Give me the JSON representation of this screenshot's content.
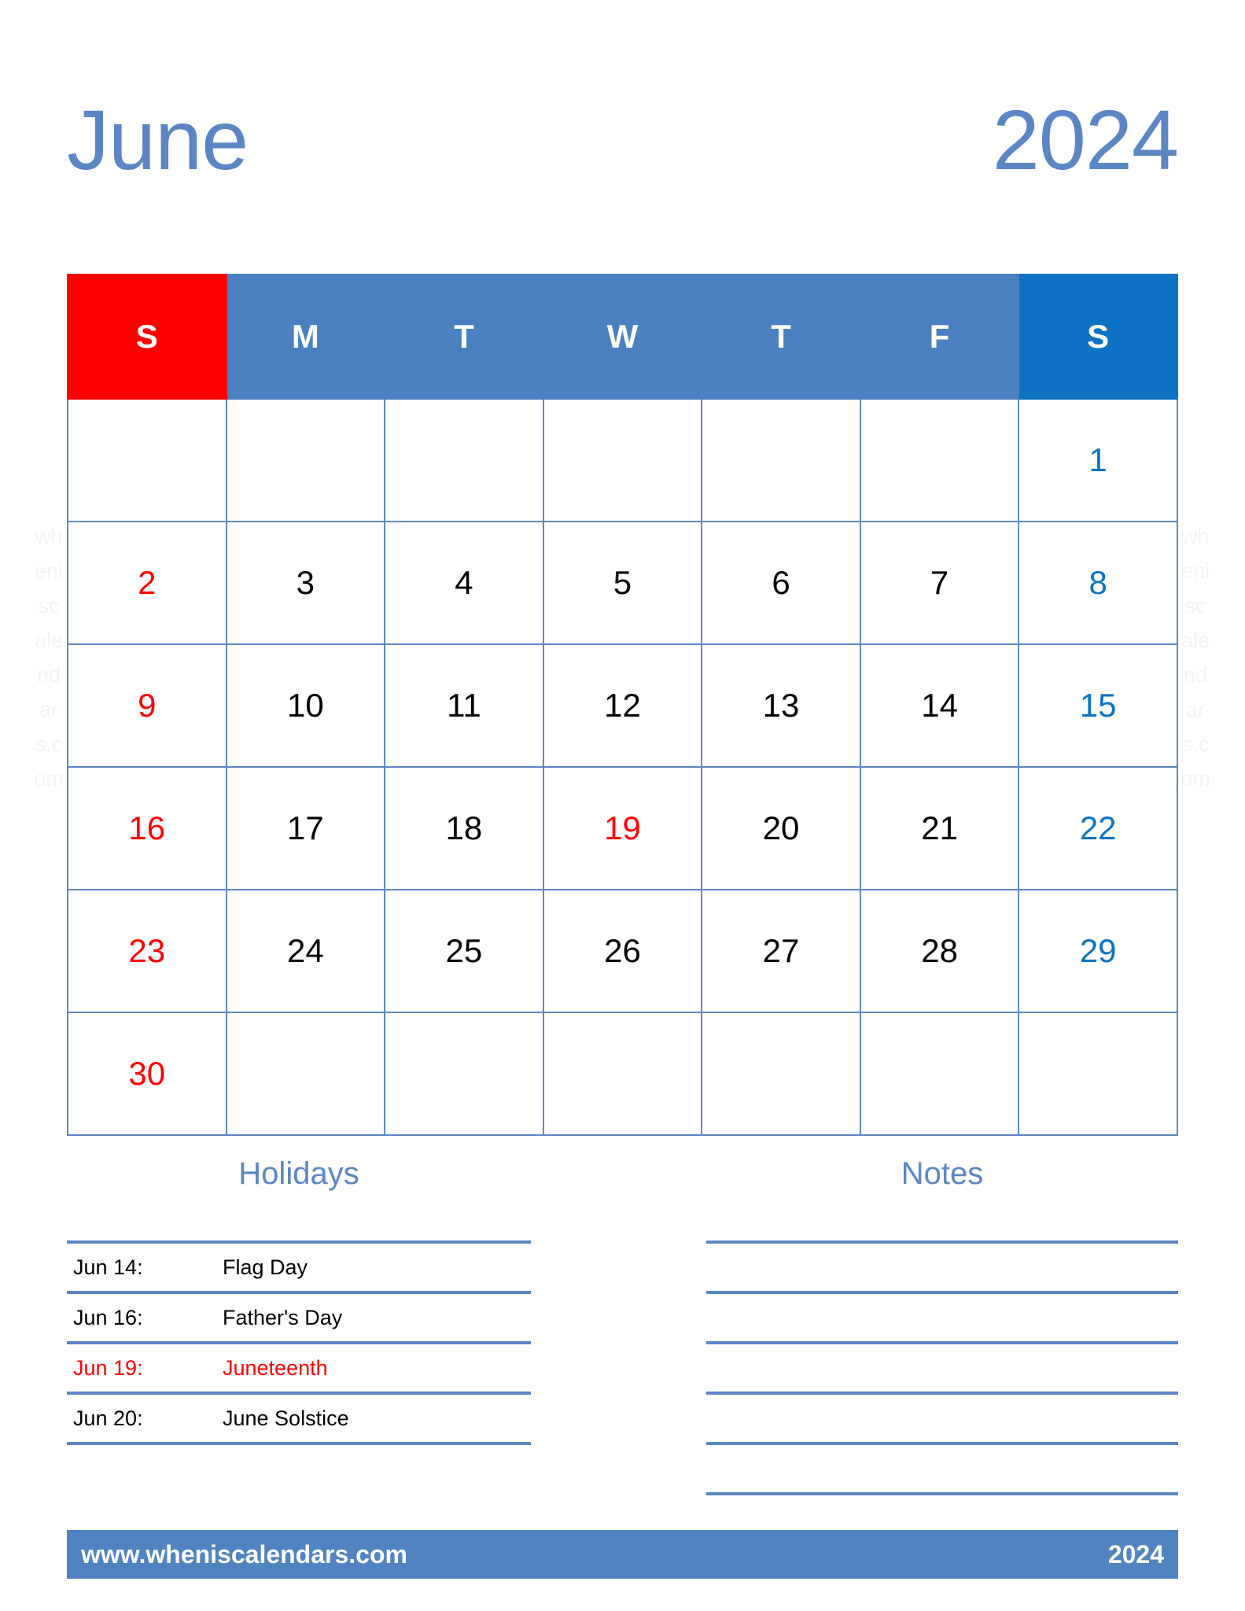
{
  "header": {
    "month": "June",
    "year": "2024"
  },
  "colors": {
    "title_blue": "#5b86c4",
    "header_blue": "#4a80c0",
    "saturday_blue": "#0b72c4",
    "sunday_red": "#ff0000",
    "grid_line": "#5b86c4",
    "footer_bar": "#5183c0"
  },
  "watermark": {
    "text": "wheniscalendars.com"
  },
  "calendar": {
    "weekday_headers": [
      {
        "label": "S",
        "kind": "sun"
      },
      {
        "label": "M",
        "kind": "weekday"
      },
      {
        "label": "T",
        "kind": "weekday"
      },
      {
        "label": "W",
        "kind": "weekday"
      },
      {
        "label": "T",
        "kind": "weekday"
      },
      {
        "label": "F",
        "kind": "weekday"
      },
      {
        "label": "S",
        "kind": "sat"
      }
    ],
    "weeks": [
      [
        {
          "day": "",
          "kind": "sun"
        },
        {
          "day": "",
          "kind": "weekday"
        },
        {
          "day": "",
          "kind": "weekday"
        },
        {
          "day": "",
          "kind": "weekday"
        },
        {
          "day": "",
          "kind": "weekday"
        },
        {
          "day": "",
          "kind": "weekday"
        },
        {
          "day": "1",
          "kind": "sat"
        }
      ],
      [
        {
          "day": "2",
          "kind": "sun"
        },
        {
          "day": "3",
          "kind": "weekday"
        },
        {
          "day": "4",
          "kind": "weekday"
        },
        {
          "day": "5",
          "kind": "weekday"
        },
        {
          "day": "6",
          "kind": "weekday"
        },
        {
          "day": "7",
          "kind": "weekday"
        },
        {
          "day": "8",
          "kind": "sat"
        }
      ],
      [
        {
          "day": "9",
          "kind": "sun"
        },
        {
          "day": "10",
          "kind": "weekday"
        },
        {
          "day": "11",
          "kind": "weekday"
        },
        {
          "day": "12",
          "kind": "weekday"
        },
        {
          "day": "13",
          "kind": "weekday"
        },
        {
          "day": "14",
          "kind": "weekday"
        },
        {
          "day": "15",
          "kind": "sat"
        }
      ],
      [
        {
          "day": "16",
          "kind": "sun"
        },
        {
          "day": "17",
          "kind": "weekday"
        },
        {
          "day": "18",
          "kind": "weekday"
        },
        {
          "day": "19",
          "kind": "holiday"
        },
        {
          "day": "20",
          "kind": "weekday"
        },
        {
          "day": "21",
          "kind": "weekday"
        },
        {
          "day": "22",
          "kind": "sat"
        }
      ],
      [
        {
          "day": "23",
          "kind": "sun"
        },
        {
          "day": "24",
          "kind": "weekday"
        },
        {
          "day": "25",
          "kind": "weekday"
        },
        {
          "day": "26",
          "kind": "weekday"
        },
        {
          "day": "27",
          "kind": "weekday"
        },
        {
          "day": "28",
          "kind": "weekday"
        },
        {
          "day": "29",
          "kind": "sat"
        }
      ],
      [
        {
          "day": "30",
          "kind": "sun"
        },
        {
          "day": "",
          "kind": "weekday"
        },
        {
          "day": "",
          "kind": "weekday"
        },
        {
          "day": "",
          "kind": "weekday"
        },
        {
          "day": "",
          "kind": "weekday"
        },
        {
          "day": "",
          "kind": "weekday"
        },
        {
          "day": "",
          "kind": "sat"
        }
      ]
    ]
  },
  "holidays": {
    "title": "Holidays",
    "items": [
      {
        "date": "Jun 14:",
        "name": "Flag Day",
        "highlight": false
      },
      {
        "date": "Jun 16:",
        "name": "Father's Day",
        "highlight": false
      },
      {
        "date": "Jun 19:",
        "name": "Juneteenth",
        "highlight": true
      },
      {
        "date": "Jun 20:",
        "name": "June Solstice",
        "highlight": false
      }
    ]
  },
  "notes": {
    "title": "Notes",
    "line_count": 5
  },
  "footer": {
    "website": "www.wheniscalendars.com",
    "year": "2024"
  }
}
